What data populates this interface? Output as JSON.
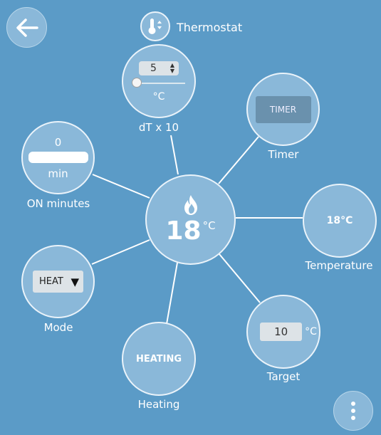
{
  "header": {
    "title": "Thermostat",
    "back_icon": "arrow-left-icon",
    "title_icon": "thermometer-icon"
  },
  "center": {
    "value": "18",
    "unit": "°C",
    "icon": "flame-icon"
  },
  "dt": {
    "value": "5",
    "unit": "°C",
    "label": "dT x 10",
    "slider_fraction": 0
  },
  "on_minutes": {
    "value": "0",
    "unit": "min",
    "label": "ON minutes"
  },
  "timer": {
    "button_label": "TIMER",
    "label": "Timer"
  },
  "temperature": {
    "value": "18°C",
    "label": "Temperature"
  },
  "mode": {
    "selected": "HEAT",
    "label": "Mode"
  },
  "heating": {
    "value": "HEATING",
    "label": "Heating"
  },
  "target": {
    "value": "10",
    "unit": "°C",
    "label": "Target"
  },
  "menu": {
    "icon": "more-vertical-icon"
  },
  "colors": {
    "background": "#5b9bc7",
    "circle_fill": "#8ab8d9",
    "circle_border": "#eaf3fa"
  }
}
